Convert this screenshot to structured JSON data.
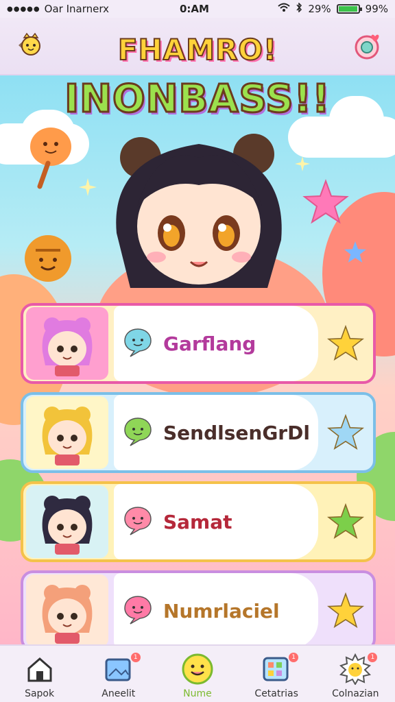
{
  "status_bar": {
    "carrier": "Oar Inarnerx",
    "time": "0:AM",
    "battery_text": "29%",
    "battery_text_2": "99%",
    "battery_level": 0.9
  },
  "header": {
    "title_line1": "FHAMRO!",
    "title_line2": "INONBASS!!",
    "back_icon": "back-chevron-icon",
    "right_icon": "chat-heart-icon"
  },
  "cards": [
    {
      "label": "Garflang",
      "label_color": "#b33a9c",
      "border": "#e85aa8",
      "avatar_bg": "#ff9fcf",
      "bubble_color": "#7fd6e6",
      "star_color": "#ffd23a",
      "star_bg": "#fff0c4",
      "hair": "#e07be0"
    },
    {
      "label": "SendlsenGrDl",
      "label_color": "#4a2e2a",
      "border": "#7bbfe8",
      "avatar_bg": "#fff6c7",
      "bubble_color": "#8fd657",
      "star_color": "#9fd7f5",
      "star_bg": "#d8f0fc",
      "hair": "#f2c33a"
    },
    {
      "label": "Samat",
      "label_color": "#b5283a",
      "border": "#f4c24a",
      "avatar_bg": "#d8f2f4",
      "bubble_color": "#ff8aa8",
      "star_color": "#7ccf4a",
      "star_bg": "#fff2b8",
      "hair": "#2f2a40"
    },
    {
      "label": "Numrlaciel",
      "label_color": "#b5762a",
      "border": "#c98ee0",
      "avatar_bg": "#ffe8d6",
      "bubble_color": "#ff7aa6",
      "star_color": "#ffd23a",
      "star_bg": "#efe0fb",
      "hair": "#f4a07a"
    }
  ],
  "tabs": [
    {
      "label": "Sapok",
      "icon": "home-icon",
      "badge": false
    },
    {
      "label": "Aneelit",
      "icon": "photo-card-icon",
      "badge": true
    },
    {
      "label": "Nume",
      "icon": "smiley-icon",
      "badge": false
    },
    {
      "label": "Cetatrias",
      "icon": "apps-grid-icon",
      "badge": true
    },
    {
      "label": "Colnazian",
      "icon": "sun-face-icon",
      "badge": true
    }
  ]
}
